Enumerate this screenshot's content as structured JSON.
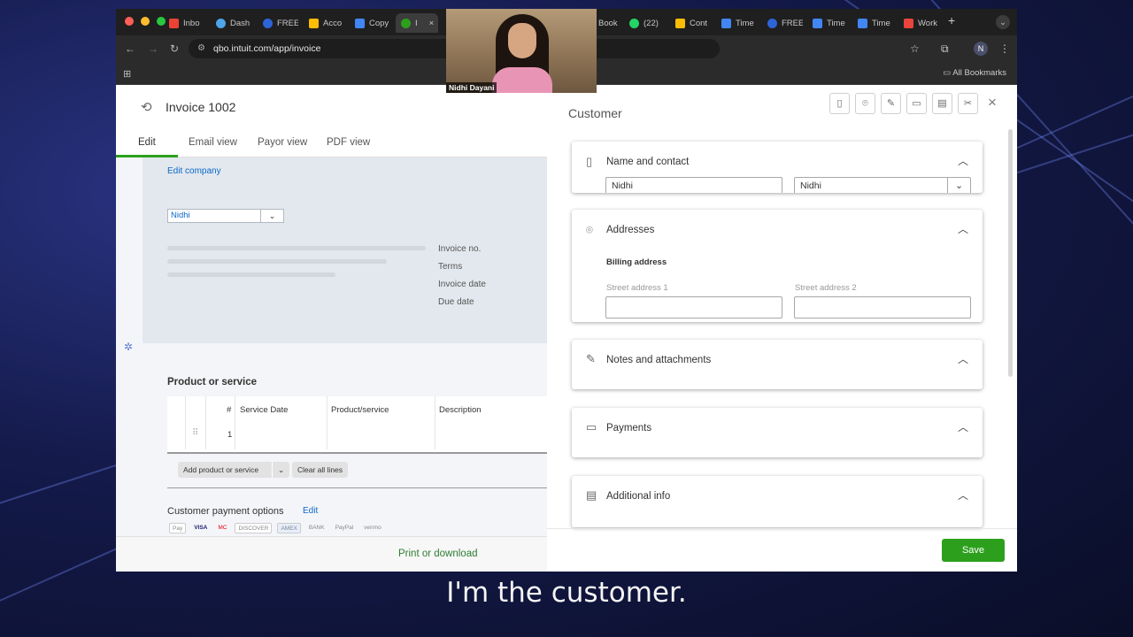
{
  "browser": {
    "tabs": [
      {
        "label": "Inbo",
        "color": "#ea4335"
      },
      {
        "label": "Dash",
        "color": "#4ea4e8"
      },
      {
        "label": "FREE",
        "color": "#2d64d8"
      },
      {
        "label": "Acco",
        "color": "#fbbc04"
      },
      {
        "label": "Copy",
        "color": "#4285f4"
      },
      {
        "label": "I",
        "color": "#2ca01c"
      },
      {
        "label": "Book",
        "color": "#4285f4"
      },
      {
        "label": "(22)",
        "color": "#25d366"
      },
      {
        "label": "Cont",
        "color": "#fbbc04"
      },
      {
        "label": "Time",
        "color": "#4285f4"
      },
      {
        "label": "FREE",
        "color": "#2d64d8"
      },
      {
        "label": "Time",
        "color": "#4285f4"
      },
      {
        "label": "Time",
        "color": "#4285f4"
      },
      {
        "label": "Work",
        "color": "#e8453c"
      }
    ],
    "url": "qbo.intuit.com/app/invoice",
    "profile_initial": "N",
    "all_bookmarks": "All Bookmarks"
  },
  "invoice": {
    "title": "Invoice 1002",
    "view_tabs": [
      "Edit",
      "Email view",
      "Payor view",
      "PDF view"
    ],
    "edit_company": "Edit company",
    "customer_select": "Nidhi",
    "meta_labels": [
      "Invoice no.",
      "Terms",
      "Invoice date",
      "Due date"
    ],
    "product_title": "Product or service",
    "columns": [
      "#",
      "Service Date",
      "Product/service",
      "Description"
    ],
    "row_number": "1",
    "add_product": "Add product or service",
    "clear_lines": "Clear all lines",
    "payment_options": "Customer payment options",
    "payment_edit": "Edit",
    "payment_logos": [
      "Pay",
      "VISA",
      "MC",
      "DISCOVER",
      "AMEX",
      "BANK",
      "PayPal",
      "venmo"
    ],
    "print": "Print or download"
  },
  "customer_panel": {
    "title": "Customer",
    "sections": [
      {
        "title": "Name and contact",
        "icon": "contact-card-icon"
      },
      {
        "title": "Addresses",
        "icon": "location-pin-icon"
      },
      {
        "title": "Notes and attachments",
        "icon": "edit-note-icon"
      },
      {
        "title": "Payments",
        "icon": "credit-card-icon"
      },
      {
        "title": "Additional info",
        "icon": "document-icon"
      }
    ],
    "first_name": "Nidhi",
    "display_name": "Nidhi",
    "billing_address": "Billing address",
    "street1_label": "Street address 1",
    "street2_label": "Street address 2",
    "save": "Save"
  },
  "webcam": {
    "name": "Nidhi Dayani"
  },
  "caption": "I'm the customer."
}
